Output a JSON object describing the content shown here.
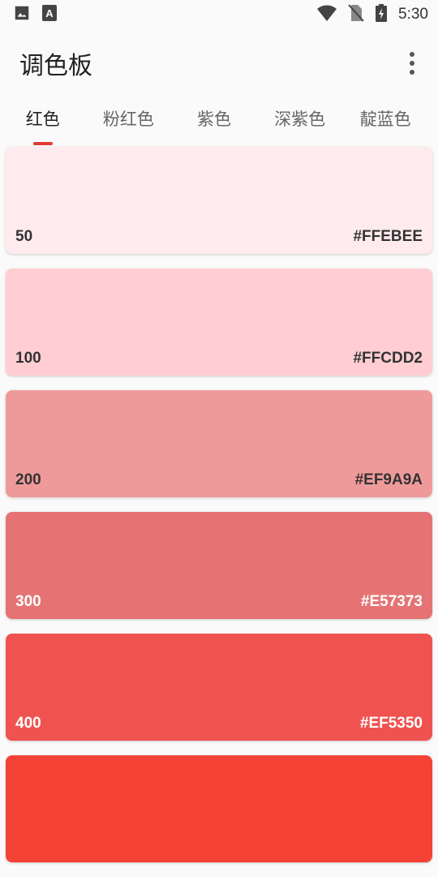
{
  "status_bar": {
    "time": "5:30",
    "left_icons": [
      "image-icon",
      "font-a-icon"
    ],
    "right_icons": [
      "wifi-icon",
      "no-sim-icon",
      "battery-charging-icon"
    ]
  },
  "app_bar": {
    "title": "调色板",
    "more_icon": "more-vert-icon"
  },
  "tabs": [
    {
      "label": "红色",
      "active": true
    },
    {
      "label": "粉红色",
      "active": false
    },
    {
      "label": "紫色",
      "active": false
    },
    {
      "label": "深紫色",
      "active": false
    },
    {
      "label": "靛蓝色",
      "active": false
    }
  ],
  "accent_color": "#E53935",
  "swatches": [
    {
      "level": "50",
      "hex": "#FFEBEE",
      "text_color": "#333333"
    },
    {
      "level": "100",
      "hex": "#FFCDD2",
      "text_color": "#333333"
    },
    {
      "level": "200",
      "hex": "#EF9A9A",
      "text_color": "#333333"
    },
    {
      "level": "300",
      "hex": "#E57373",
      "text_color": "#FFFFFF"
    },
    {
      "level": "400",
      "hex": "#EF5350",
      "text_color": "#FFFFFF"
    },
    {
      "level": "",
      "hex": "",
      "color": "#F44336",
      "text_color": "#FFFFFF"
    }
  ]
}
